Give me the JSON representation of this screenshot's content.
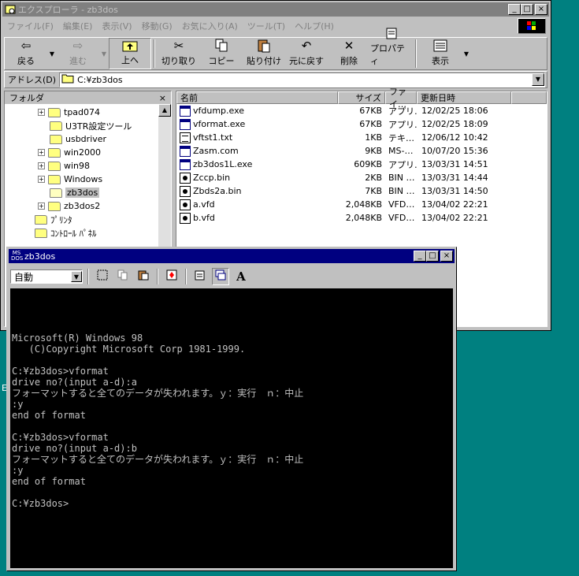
{
  "explorer": {
    "title": "エクスプローラ - zb3dos",
    "menu": [
      "ファイル(F)",
      "編集(E)",
      "表示(V)",
      "移動(G)",
      "お気に入り(A)",
      "ツール(T)",
      "ヘルプ(H)"
    ],
    "toolbar": {
      "back": "戻る",
      "forward": "進む",
      "up": "上へ",
      "cut": "切り取り",
      "copy": "コピー",
      "paste": "貼り付け",
      "undo": "元に戻す",
      "delete": "削除",
      "properties": "プロパティ",
      "view": "表示"
    },
    "address_label": "アドレス(D)",
    "address_value": "C:¥zb3dos",
    "folder_pane_title": "フォルダ",
    "folder_pane_close": "×",
    "tree": [
      {
        "label": "tpad074",
        "expander": "+"
      },
      {
        "label": "U3TR設定ツール",
        "expander": ""
      },
      {
        "label": "usbdriver",
        "expander": ""
      },
      {
        "label": "win2000",
        "expander": "+"
      },
      {
        "label": "win98",
        "expander": "+"
      },
      {
        "label": "Windows",
        "expander": "+"
      },
      {
        "label": "zb3dos",
        "expander": ""
      },
      {
        "label": "zb3dos2",
        "expander": "+"
      },
      {
        "label": "ﾌﾟﾘﾝﾀ",
        "expander": ""
      },
      {
        "label": "ｺﾝﾄﾛｰﾙ ﾊﾟﾈﾙ",
        "expander": ""
      }
    ],
    "columns": {
      "name": "名前",
      "size": "サイズ",
      "type": "ファイ…",
      "date": "更新日時"
    },
    "files": [
      {
        "name": "vfdump.exe",
        "size": "67KB",
        "type": "アプリ…",
        "date": "12/02/25 18:06",
        "icon": "exe"
      },
      {
        "name": "vformat.exe",
        "size": "67KB",
        "type": "アプリ…",
        "date": "12/02/25 18:09",
        "icon": "exe"
      },
      {
        "name": "vftst1.txt",
        "size": "1KB",
        "type": "テキ…",
        "date": "12/06/12 10:42",
        "icon": "txt"
      },
      {
        "name": "Zasm.com",
        "size": "9KB",
        "type": "MS-…",
        "date": "10/07/20 15:36",
        "icon": "exe"
      },
      {
        "name": "zb3dos1L.exe",
        "size": "609KB",
        "type": "アプリ…",
        "date": "13/03/31 14:51",
        "icon": "exe"
      },
      {
        "name": "Zccp.bin",
        "size": "2KB",
        "type": "BIN …",
        "date": "13/03/31 14:44",
        "icon": "bin"
      },
      {
        "name": "Zbds2a.bin",
        "size": "7KB",
        "type": "BIN …",
        "date": "13/03/31 14:50",
        "icon": "bin"
      },
      {
        "name": "a.vfd",
        "size": "2,048KB",
        "type": "VFD…",
        "date": "13/04/02 22:21",
        "icon": "bin"
      },
      {
        "name": "b.vfd",
        "size": "2,048KB",
        "type": "VFD…",
        "date": "13/04/02 22:21",
        "icon": "bin"
      }
    ]
  },
  "dos": {
    "title": "zb3dos",
    "font_size_value": "自動",
    "console_lines": [
      "Microsoft(R) Windows 98",
      "   (C)Copyright Microsoft Corp 1981-1999.",
      "",
      "C:¥zb3dos>vformat",
      "drive no?(input a-d):a",
      "フォーマットすると全てのデータが失われます。ｙ：実行　ｎ：中止",
      ":y",
      "end of format",
      "",
      "C:¥zb3dos>vformat",
      "drive no?(input a-d):b",
      "フォーマットすると全てのデータが失われます。ｙ：実行　ｎ：中止",
      ":y",
      "end of format",
      "",
      "C:¥zb3dos>"
    ]
  },
  "colors": {
    "desktop": "#008080",
    "titlebar_active": "#000080",
    "titlebar_inactive": "#808080"
  }
}
